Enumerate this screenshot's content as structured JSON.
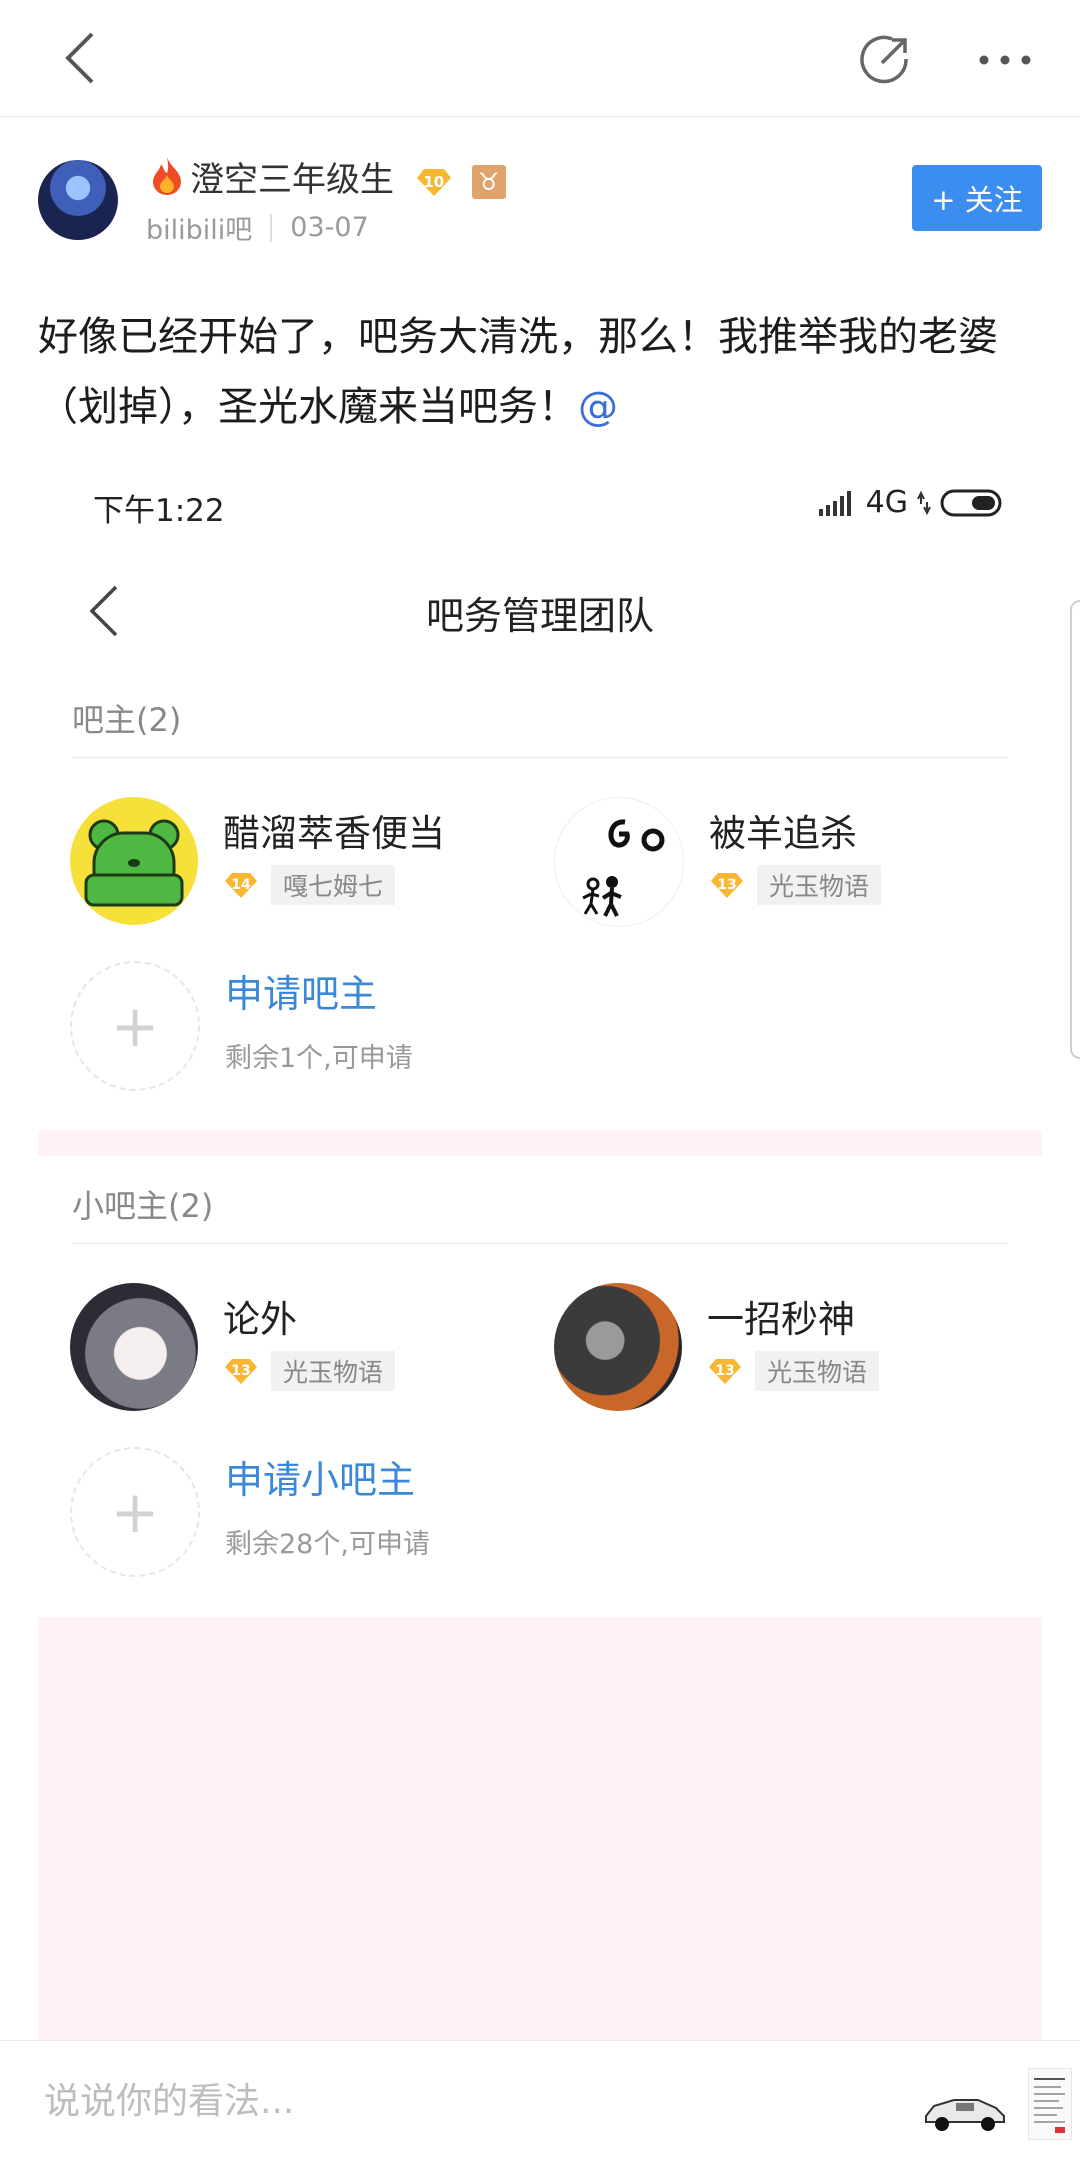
{
  "author": {
    "name": "澄空三年级生",
    "level": "10",
    "zodiac_glyph": "♉",
    "source": "bilibili吧",
    "date": "03-07"
  },
  "follow_label": "+ 关注",
  "post": {
    "text": "好像已经开始了，吧务大清洗，那么！我推举我的老婆（划掉），圣光水魔来当吧务！",
    "mention": "@"
  },
  "screenshot": {
    "status_time": "下午1:22",
    "status_network": "4G",
    "title": "吧务管理团队",
    "owners": {
      "title": "吧主(2)",
      "members": [
        {
          "name": "醋溜萃香便当",
          "level": "14",
          "tag": "嘎七姆七"
        },
        {
          "name": "被羊追杀",
          "level": "13",
          "tag": "光玉物语"
        }
      ],
      "apply_title": "申请吧主",
      "apply_sub": "剩余1个,可申请"
    },
    "sub_owners": {
      "title": "小吧主(2)",
      "members": [
        {
          "name": "论外",
          "level": "13",
          "tag": "光玉物语"
        },
        {
          "name": "一招秒神",
          "level": "13",
          "tag": "光玉物语"
        }
      ],
      "apply_title": "申请小吧主",
      "apply_sub": "剩余28个,可申请"
    }
  },
  "comment_placeholder": "说说你的看法...",
  "colors": {
    "accent_blue": "#3c8df0",
    "link_blue": "#3c88d8",
    "level_badge": "#f7b733",
    "pink_band": "#fff2f4"
  }
}
